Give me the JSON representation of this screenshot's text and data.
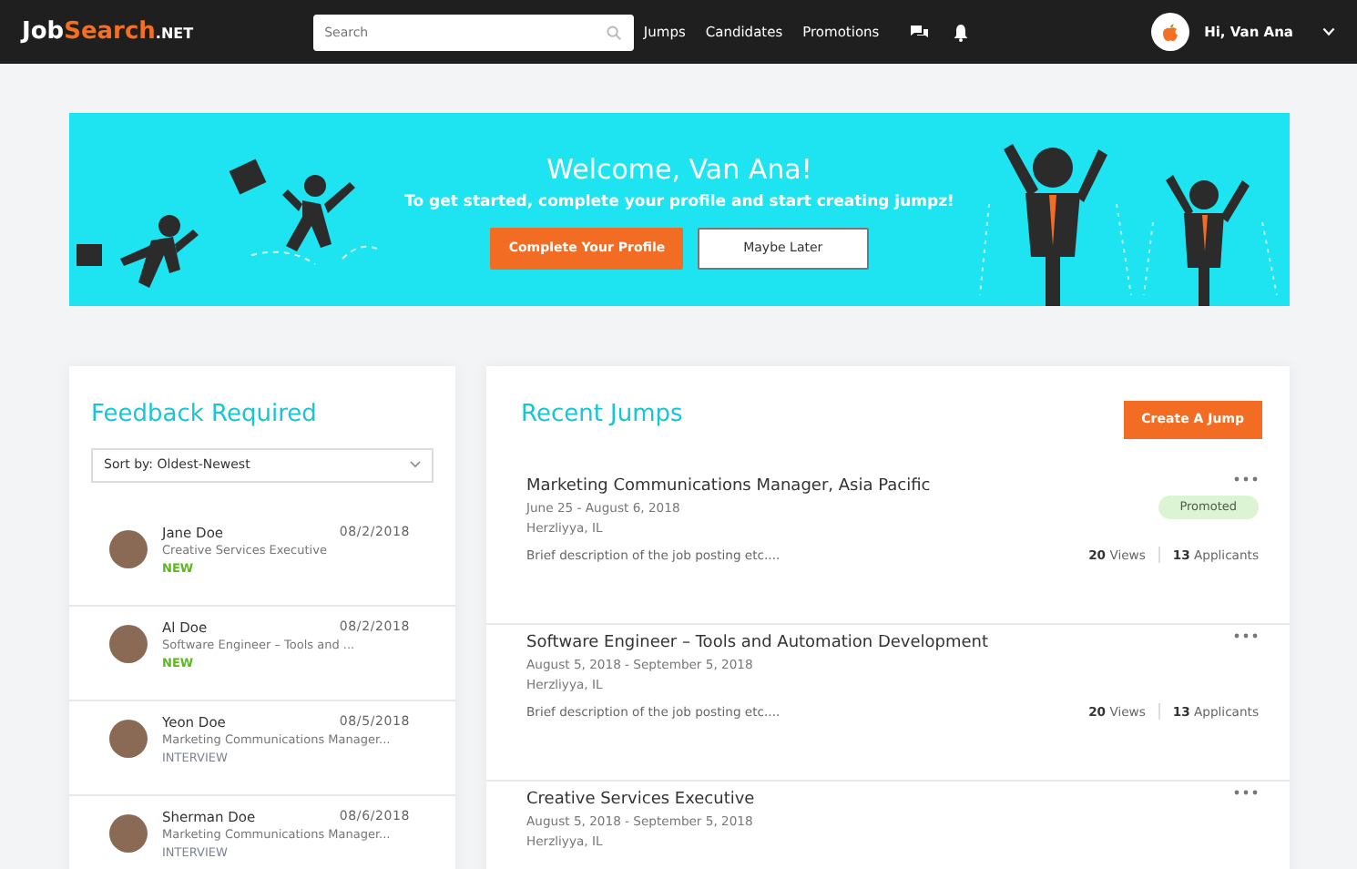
{
  "navbar": {
    "logo": [
      "Job",
      "Search",
      ".NET"
    ],
    "search": {
      "placeholder": "Search"
    },
    "links": [
      "Jumps",
      "Candidates",
      "Promotions"
    ],
    "user": "Hi, Van Ana"
  },
  "banner": {
    "title": "Welcome, Van Ana!",
    "subtitle": "To get started, complete your profile and start creating jumpz!",
    "buttons": [
      {
        "label": "Complete Your Profile",
        "kind": "primary"
      },
      {
        "label": "Maybe Later",
        "kind": "secondary"
      }
    ]
  },
  "feedback": {
    "title": "Feedback Required",
    "sort": "Sort by: Oldest-Newest",
    "items": [
      {
        "name": "Jane Doe",
        "date": "08/2/2018",
        "role": "Creative Services Executive",
        "status": "NEW",
        "kind": "new"
      },
      {
        "name": "Al Doe",
        "date": "08/2/2018",
        "role": "Software Engineer – Tools and ...",
        "status": "NEW",
        "kind": "new"
      },
      {
        "name": "Yeon Doe",
        "date": "08/5/2018",
        "role": "Marketing Communications Manager...",
        "status": "INTERVIEW",
        "kind": "interview"
      },
      {
        "name": "Sherman Doe",
        "date": "08/6/2018",
        "role": "Marketing Communications Manager...",
        "status": "INTERVIEW",
        "kind": "interview"
      }
    ]
  },
  "jumps": {
    "title": "Recent Jumps",
    "create_button": "Create A Jump",
    "items": [
      {
        "title": "Marketing Communications Manager, Asia Pacific",
        "dates": "June 25 - August 6, 2018",
        "location": "Herzliyya, IL",
        "description": "Brief description of the job posting etc....",
        "promoted": true,
        "badge": "Promoted",
        "views": "20",
        "views_label": "Views",
        "applicants": "13",
        "applicants_label": "Applicants"
      },
      {
        "title": "Software Engineer – Tools and Automation Development",
        "dates": "August 5, 2018 - September 5, 2018",
        "location": "Herzliyya, IL",
        "description": "Brief description of the job posting etc....",
        "promoted": false,
        "views": "20",
        "views_label": "Views",
        "applicants": "13",
        "applicants_label": "Applicants"
      },
      {
        "title": "Creative Services Executive",
        "dates": "August 5, 2018 - September 5, 2018",
        "location": "Herzliyya, IL",
        "promoted": false
      }
    ]
  }
}
